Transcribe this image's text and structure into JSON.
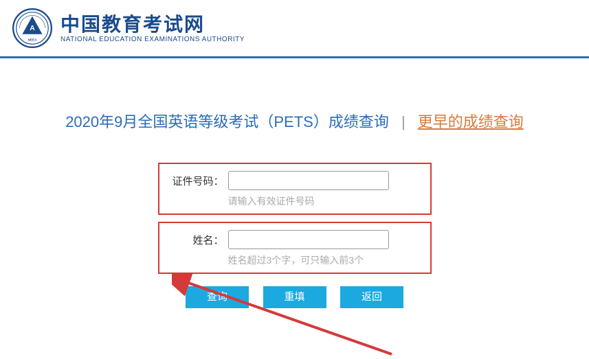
{
  "header": {
    "site_title": "中国教育考试网",
    "site_subtitle": "NATIONAL EDUCATION EXAMINATIONS AUTHORITY"
  },
  "page": {
    "title": "2020年9月全国英语等级考试（PETS）成绩查询",
    "separator": "|",
    "earlier_link": "更早的成绩查询"
  },
  "form": {
    "id_number": {
      "label": "证件号码：",
      "value": "",
      "hint": "请输入有效证件号码"
    },
    "name": {
      "label": "姓名：",
      "value": "",
      "hint": "姓名超过3个字，可只输入前3个"
    }
  },
  "buttons": {
    "query": "查询",
    "reset": "重填",
    "back": "返回"
  },
  "colors": {
    "primary": "#2a6cb8",
    "button": "#1ba9e0",
    "highlight_border": "#d43a3a",
    "link": "#d97a3a"
  }
}
